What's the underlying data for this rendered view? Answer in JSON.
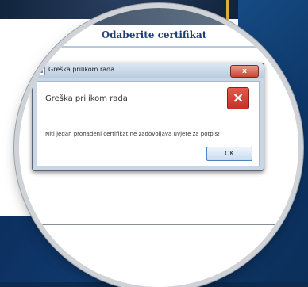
{
  "background": {
    "header_title": "Odaberite certifikat"
  },
  "dialog": {
    "title": "Greška prilikom rada",
    "heading": "Greška prilikom rada",
    "message": "Niti jedan pronađeni certifikat ne zadovoljava uvjete za potpis!",
    "ok_label": "OK",
    "close_symbol": "x",
    "error_symbol": "×",
    "icons": {
      "app": "app-window-icon",
      "error": "error-x-icon",
      "close": "close-icon"
    },
    "colors": {
      "accent": "#c8452f",
      "title_text": "#1a3e7a",
      "button_border": "#4d86c4"
    }
  }
}
